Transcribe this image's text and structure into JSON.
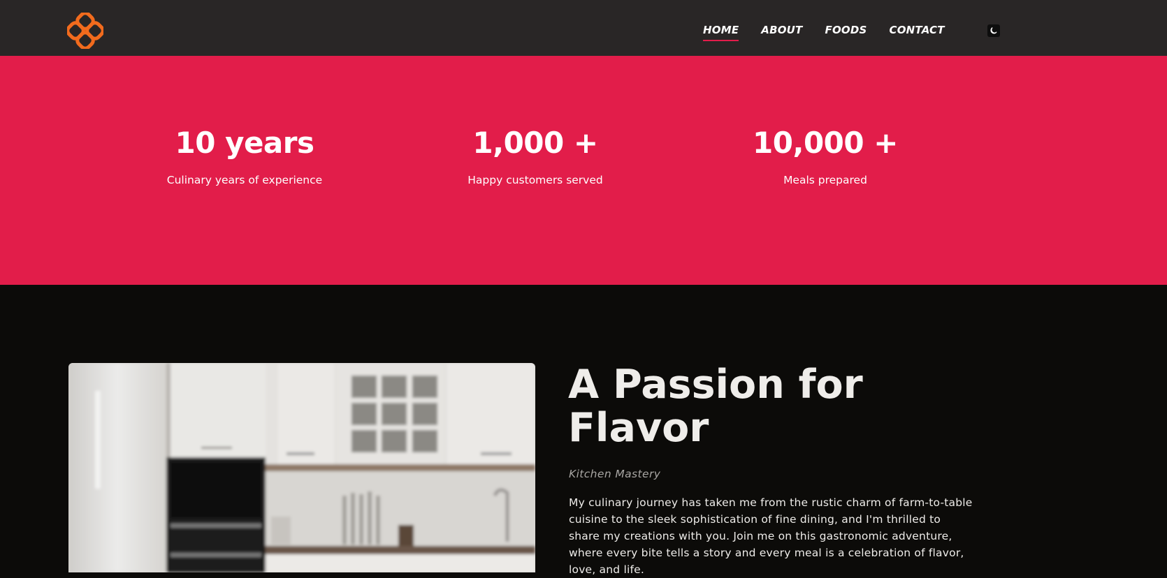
{
  "nav": {
    "logo_icon": "orange-clover-logo-icon",
    "links": [
      {
        "label": "HOME",
        "active": true
      },
      {
        "label": "ABOUT",
        "active": false
      },
      {
        "label": "FOODS",
        "active": false
      },
      {
        "label": "CONTACT",
        "active": false
      }
    ],
    "theme_toggle_icon": "moon-icon"
  },
  "stats": [
    {
      "value": "10 years",
      "label": "Culinary years of experience"
    },
    {
      "value": "1,000 +",
      "label": "Happy customers served"
    },
    {
      "value": "10,000 +",
      "label": "Meals prepared"
    }
  ],
  "about": {
    "title": "A Passion for Flavor",
    "subtitle": "Kitchen Mastery",
    "text": "My culinary journey has taken me from the rustic charm of farm-to-table cuisine to the sleek sophistication of fine dining, and I'm thrilled to share my creations with you. Join me on this gastronomic adventure, where every bite tells a story and every meal is a celebration of flavor, love, and life."
  },
  "colors": {
    "accent": "#e21d4a",
    "logo": "#f26b1d",
    "navbar_bg": "#292626",
    "page_bg": "#0c0b09"
  }
}
